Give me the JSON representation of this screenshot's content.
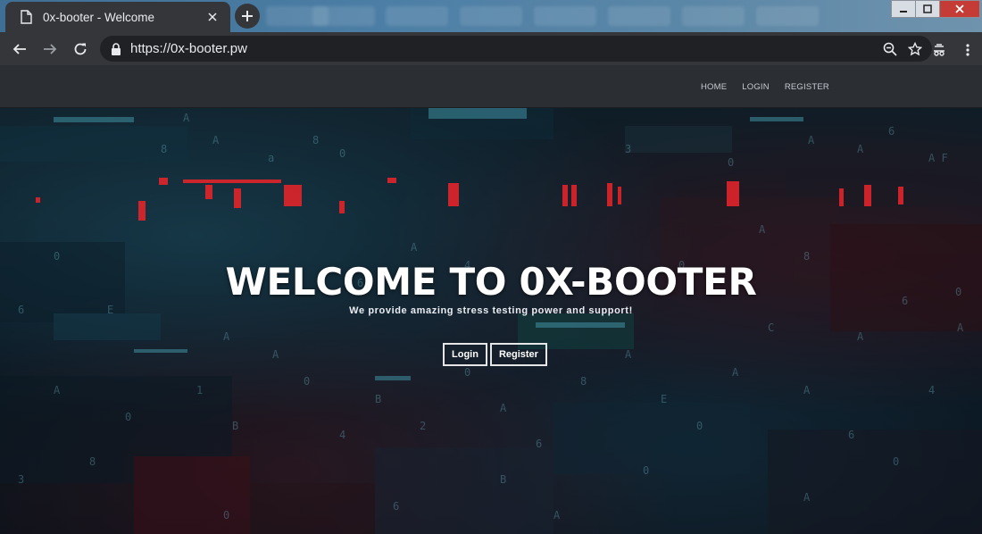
{
  "browser": {
    "tab_title": "0x-booter - Welcome",
    "url": "https://0x-booter.pw"
  },
  "site": {
    "nav": [
      "HOME",
      "LOGIN",
      "REGISTER"
    ],
    "hero": {
      "title": "WELCOME TO 0X-BOOTER",
      "subtitle": "We provide amazing stress testing power and support!",
      "buttons": [
        "Login",
        "Register"
      ]
    }
  },
  "colors": {
    "chrome_dark": "#35363a",
    "omnibox": "#202124",
    "site_header": "#2b2e33",
    "hero_text": "#ffffff",
    "glyph_red": "#e0242a",
    "glyph_teal": "#4fa7b5"
  },
  "icons": [
    "page-icon",
    "close-icon",
    "plus-icon",
    "back-icon",
    "forward-icon",
    "reload-icon",
    "lock-icon",
    "zoom-icon",
    "star-icon",
    "extension-icon",
    "menu-icon"
  ]
}
